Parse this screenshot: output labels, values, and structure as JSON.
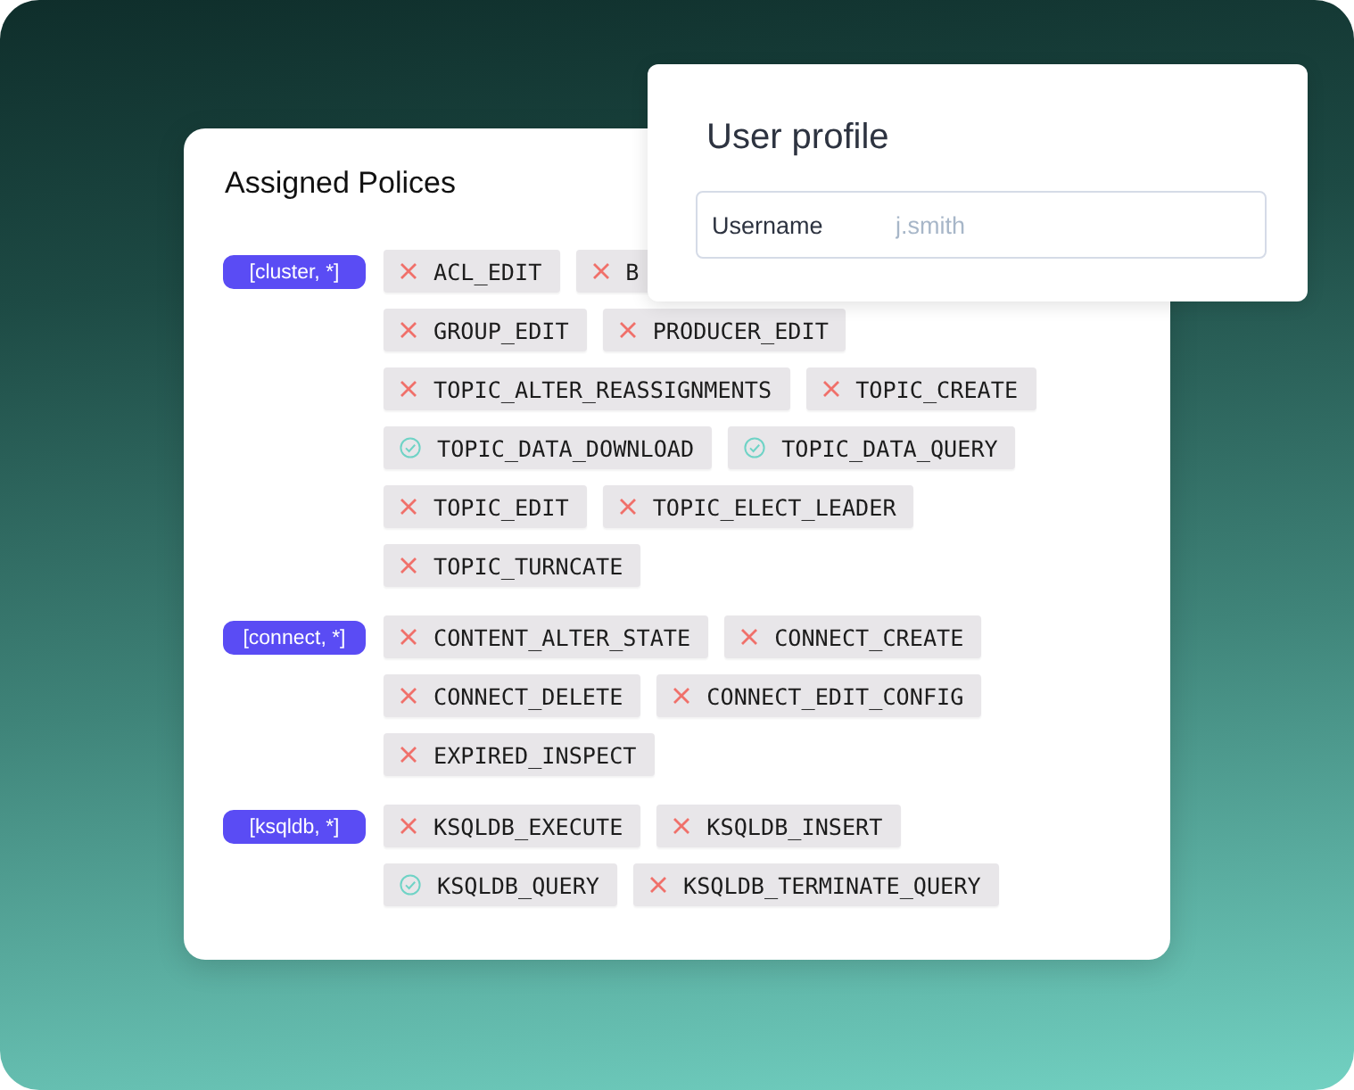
{
  "policies_card": {
    "title": "Assigned Polices",
    "groups": [
      {
        "tag": "[cluster, *]",
        "rows": [
          [
            {
              "label": "ACL_EDIT",
              "allowed": false
            },
            {
              "label": "B",
              "allowed": false
            }
          ],
          [
            {
              "label": "GROUP_EDIT",
              "allowed": false
            },
            {
              "label": "PRODUCER_EDIT",
              "allowed": false
            }
          ],
          [
            {
              "label": "TOPIC_ALTER_REASSIGNMENTS",
              "allowed": false
            },
            {
              "label": "TOPIC_CREATE",
              "allowed": false
            }
          ],
          [
            {
              "label": "TOPIC_DATA_DOWNLOAD",
              "allowed": true
            },
            {
              "label": "TOPIC_DATA_QUERY",
              "allowed": true
            }
          ],
          [
            {
              "label": "TOPIC_EDIT",
              "allowed": false
            },
            {
              "label": "TOPIC_ELECT_LEADER",
              "allowed": false
            }
          ],
          [
            {
              "label": "TOPIC_TURNCATE",
              "allowed": false
            }
          ]
        ]
      },
      {
        "tag": "[connect, *]",
        "rows": [
          [
            {
              "label": "CONTENT_ALTER_STATE",
              "allowed": false
            },
            {
              "label": "CONNECT_CREATE",
              "allowed": false
            }
          ],
          [
            {
              "label": "CONNECT_DELETE",
              "allowed": false
            },
            {
              "label": "CONNECT_EDIT_CONFIG",
              "allowed": false
            }
          ],
          [
            {
              "label": "EXPIRED_INSPECT",
              "allowed": false
            }
          ]
        ]
      },
      {
        "tag": "[ksqldb, *]",
        "rows": [
          [
            {
              "label": "KSQLDB_EXECUTE",
              "allowed": false
            },
            {
              "label": "KSQLDB_INSERT",
              "allowed": false
            }
          ],
          [
            {
              "label": "KSQLDB_QUERY",
              "allowed": true
            },
            {
              "label": "KSQLDB_TERMINATE_QUERY",
              "allowed": false
            }
          ]
        ]
      }
    ]
  },
  "profile_card": {
    "title": "User profile",
    "field": {
      "label": "Username",
      "placeholder": "j.smith"
    }
  }
}
